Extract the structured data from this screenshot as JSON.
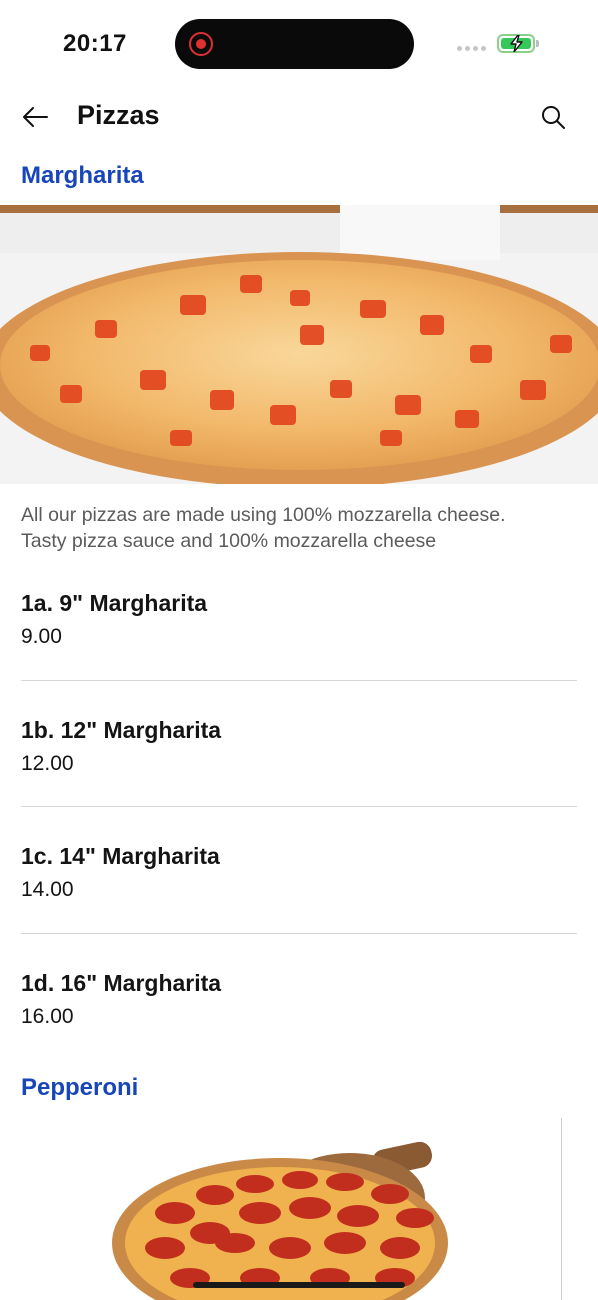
{
  "status_bar": {
    "time": "20:17"
  },
  "header": {
    "title": "Pizzas",
    "back_icon": "arrow-left-icon",
    "search_icon": "search-icon"
  },
  "sections": [
    {
      "title": "Margharita",
      "description_lines": [
        "All our pizzas are made using 100% mozzarella cheese.",
        "Tasty pizza sauce and 100% mozzarella cheese"
      ],
      "items": [
        {
          "name": "1a. 9\" Margharita",
          "price": "9.00"
        },
        {
          "name": "1b. 12\" Margharita",
          "price": "12.00"
        },
        {
          "name": "1c. 14\" Margharita",
          "price": "14.00"
        },
        {
          "name": "1d. 16\" Margharita",
          "price": "16.00"
        }
      ]
    },
    {
      "title": "Pepperoni"
    }
  ],
  "colors": {
    "section_title": "#1846b9",
    "text": "#141414",
    "muted": "#5b5b5b",
    "divider": "#d8d8d8"
  }
}
